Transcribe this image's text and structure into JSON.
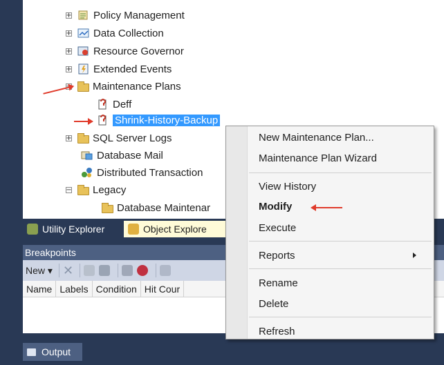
{
  "tree": {
    "items": [
      {
        "label": "Policy Management",
        "expander": "+",
        "icon": "policy-icon"
      },
      {
        "label": "Data Collection",
        "expander": "+",
        "icon": "chart-icon"
      },
      {
        "label": "Resource Governor",
        "expander": "+",
        "icon": "governor-icon"
      },
      {
        "label": "Extended Events",
        "expander": "+",
        "icon": "events-icon"
      },
      {
        "label": "Maintenance Plans",
        "expander": "−",
        "icon": "folder-icon"
      },
      {
        "label": "Deff",
        "icon": "plan-icon"
      },
      {
        "label": "Shrink-History-Backup",
        "icon": "plan-icon",
        "selected": true
      },
      {
        "label": "SQL Server Logs",
        "expander": "+",
        "icon": "folder-icon"
      },
      {
        "label": "Database Mail",
        "icon": "mail-icon"
      },
      {
        "label": "Distributed Transaction",
        "icon": "transaction-icon"
      },
      {
        "label": "Legacy",
        "expander": "−",
        "icon": "folder-icon"
      },
      {
        "label": "Database Maintenar",
        "icon": "folder-icon"
      }
    ]
  },
  "tabs": {
    "utility": "Utility Explorer",
    "object": "Object Explore"
  },
  "breakpoints": {
    "title": "Breakpoints",
    "new_label": "New",
    "columns": [
      "Name",
      "Labels",
      "Condition",
      "Hit Cour"
    ]
  },
  "output": {
    "label": "Output"
  },
  "context_menu": {
    "items": [
      {
        "label": "New Maintenance Plan..."
      },
      {
        "label": "Maintenance Plan Wizard"
      },
      {
        "label": "View History"
      },
      {
        "label": "Modify",
        "bold": true
      },
      {
        "label": "Execute"
      },
      {
        "label": "Reports",
        "submenu": true
      },
      {
        "label": "Rename"
      },
      {
        "label": "Delete"
      },
      {
        "label": "Refresh"
      }
    ]
  },
  "colors": {
    "annotation_arrow": "#e03a2a",
    "selection": "#3399ff",
    "frame": "#293955"
  }
}
